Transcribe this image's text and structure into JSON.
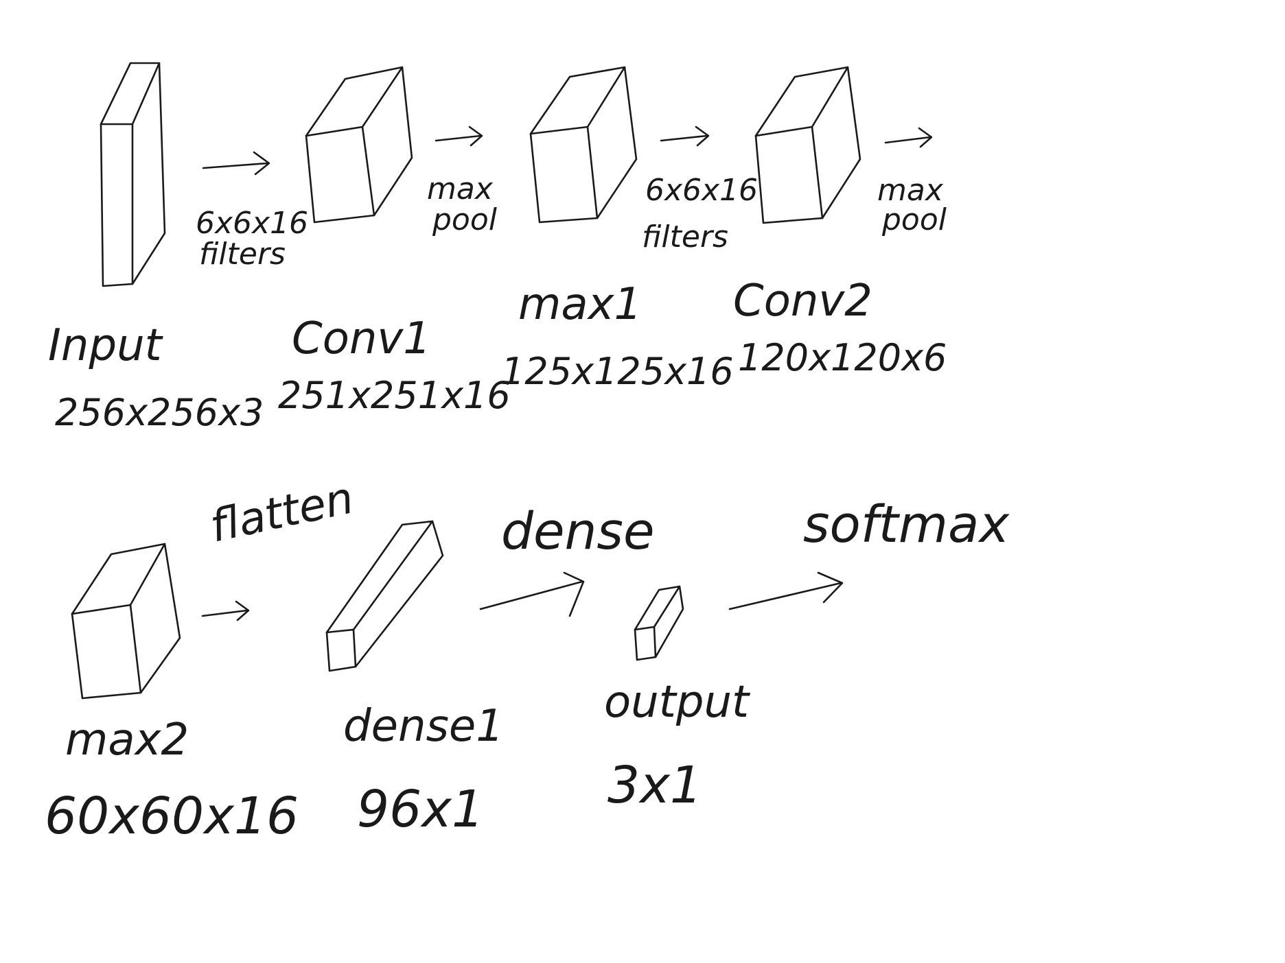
{
  "diagram": {
    "layers": [
      {
        "name": "Input",
        "dims": "256x256x3"
      },
      {
        "name": "Conv1",
        "dims": "251x251x16"
      },
      {
        "name": "max1",
        "dims": "125x125x16"
      },
      {
        "name": "Conv2",
        "dims": "120x120x6"
      },
      {
        "name": "max2",
        "dims": "60x60x16"
      },
      {
        "name": "dense1",
        "dims": "96x1"
      },
      {
        "name": "output",
        "dims": "3x1"
      }
    ],
    "operations": [
      {
        "line1": "6x6x16",
        "line2": "filters"
      },
      {
        "line1": "max",
        "line2": "pool"
      },
      {
        "line1": "6x6x16",
        "line2": "filters"
      },
      {
        "line1": "max",
        "line2": "pool"
      },
      {
        "label": "flatten"
      },
      {
        "label": "dense"
      },
      {
        "label": "softmax"
      }
    ]
  }
}
